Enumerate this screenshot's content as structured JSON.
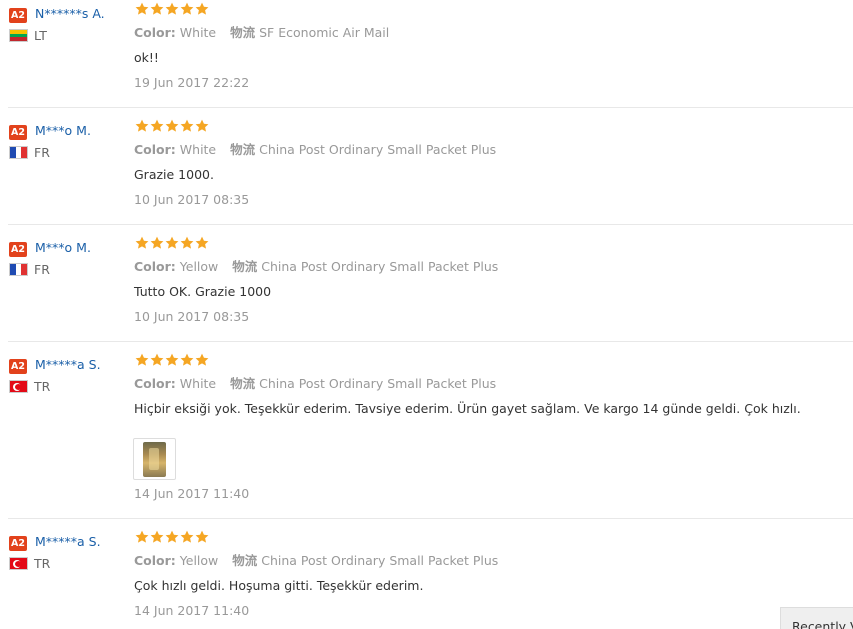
{
  "reviews": [
    {
      "badge": "A2",
      "name": "N******s A.",
      "country": "LT",
      "flag": [
        "#f4c300",
        "#00a651",
        "#c1272d"
      ],
      "flag_dir": "h",
      "rating": 5,
      "color_label": "Color:",
      "color_value": "White",
      "logistics_label": "物流",
      "logistics_value": "SF Economic Air Mail",
      "text": "ok!!",
      "date": "19 Jun 2017 22:22"
    },
    {
      "badge": "A2",
      "name": "M***o M.",
      "country": "FR",
      "flag": [
        "#1f4bb2",
        "#ffffff",
        "#e03232"
      ],
      "flag_dir": "v",
      "rating": 5,
      "color_label": "Color:",
      "color_value": "White",
      "logistics_label": "物流",
      "logistics_value": "China Post Ordinary Small Packet Plus",
      "text": "Grazie 1000.",
      "date": "10 Jun 2017 08:35"
    },
    {
      "badge": "A2",
      "name": "M***o M.",
      "country": "FR",
      "flag": [
        "#1f4bb2",
        "#ffffff",
        "#e03232"
      ],
      "flag_dir": "v",
      "rating": 5,
      "color_label": "Color:",
      "color_value": "Yellow",
      "logistics_label": "物流",
      "logistics_value": "China Post Ordinary Small Packet Plus",
      "text": "Tutto OK. Grazie 1000",
      "date": "10 Jun 2017 08:35"
    },
    {
      "badge": "A2",
      "name": "M*****a S.",
      "country": "TR",
      "flag": [
        "#e30a17"
      ],
      "flag_dir": "tr",
      "rating": 5,
      "color_label": "Color:",
      "color_value": "White",
      "logistics_label": "物流",
      "logistics_value": "China Post Ordinary Small Packet Plus",
      "text": "Hiçbir eksiği yok. Teşekkür ederim. Tavsiye ederim. Ürün gayet sağlam. Ve kargo 14 günde geldi. Çok hızlı.",
      "date": "14 Jun 2017 11:40",
      "has_photo": true
    },
    {
      "badge": "A2",
      "name": "M*****a S.",
      "country": "TR",
      "flag": [
        "#e30a17"
      ],
      "flag_dir": "tr",
      "rating": 5,
      "color_label": "Color:",
      "color_value": "Yellow",
      "logistics_label": "物流",
      "logistics_value": "China Post Ordinary Small Packet Plus",
      "text": "Çok hızlı geldi. Hoşuma gitti. Teşekkür ederim.",
      "date": "14 Jun 2017 11:40"
    }
  ],
  "star_color": "#f5a623",
  "recently_viewed_label": "Recently V"
}
